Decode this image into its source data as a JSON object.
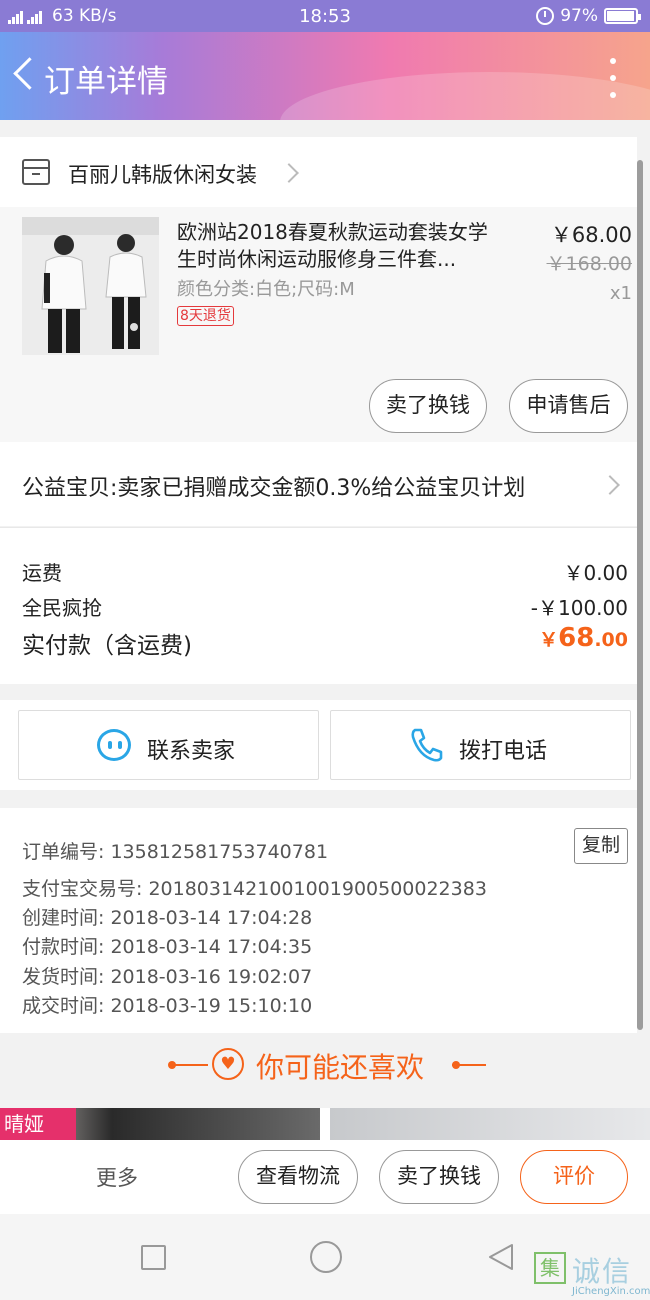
{
  "status_bar": {
    "network": "2G 4G 4G",
    "speed": "63 KB/s",
    "time": "18:53",
    "battery": "97%",
    "battery_level": 0.97
  },
  "header": {
    "title": "订单详情",
    "icons": [
      "back-arrow-icon",
      "more-vertical-icon"
    ]
  },
  "shop": {
    "name": "百丽儿韩版休闲女装",
    "icon": "store-icon"
  },
  "product": {
    "name": "欧洲站2018春夏秋款运动套装女学生时尚休闲运动服修身三件套...",
    "attributes": "颜色分类:白色;尺码:M",
    "badge": "8天退货",
    "price": "￥68.00",
    "original_price": "￥168.00",
    "quantity": "x1",
    "actions": [
      "卖了换钱",
      "申请售后"
    ]
  },
  "charity": {
    "text": "公益宝贝:卖家已捐赠成交金额0.3%给公益宝贝计划"
  },
  "fees": {
    "shipping_label": "运费",
    "shipping_value": "￥0.00",
    "discount_label": "全民疯抢",
    "discount_value": "-￥100.00",
    "total_label": "实付款（含运费)",
    "total_currency": "￥",
    "total_int": "68",
    "total_dec": ".00"
  },
  "contact": {
    "seller": "联系卖家",
    "call": "拨打电话",
    "colors": {
      "icon": "#2aa6e6"
    }
  },
  "order_info": {
    "order_no": "订单编号: 135812581753740781",
    "copy_label": "复制",
    "alipay_no": "支付宝交易号: 2018031421001001900500022383",
    "created": "创建时间: 2018-03-14 17:04:28",
    "paid": "付款时间: 2018-03-14 17:04:35",
    "shipped": "发货时间: 2018-03-16 19:02:07",
    "completed": "成交时间: 2018-03-19 15:10:10"
  },
  "recommend": {
    "title": "你可能还喜欢",
    "brand_text": "晴娅",
    "icon": "heart-icon"
  },
  "bottom_bar": {
    "more": "更多",
    "logistics": "查看物流",
    "resell": "卖了换钱",
    "review": "评价"
  },
  "watermark": {
    "box_char": "集",
    "cn": "诚信",
    "en": "JiChengXin.com"
  },
  "colors": {
    "accent": "#f5631a",
    "badge_red": "#e4393c",
    "header_gradient": [
      "#6fa0f0",
      "#a77bd8",
      "#f07ab0",
      "#f6a48c"
    ]
  }
}
